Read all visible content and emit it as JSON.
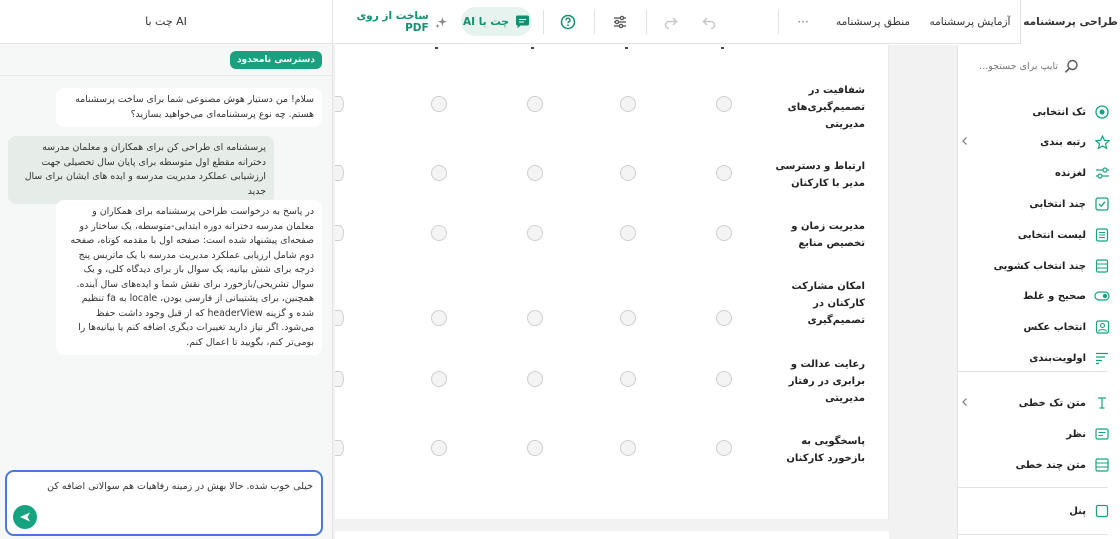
{
  "chat": {
    "title": "چت با AI",
    "badge": "دسترسی نامحدود",
    "messages": [
      {
        "role": "ai",
        "text": "سلام! من دستیار هوش مصنوعی شما برای ساخت پرسشنامه هستم. چه نوع پرسشنامه‌ای می‌خواهید بسازید؟"
      },
      {
        "role": "user",
        "text": "پرسشنامه ای طراحی کن برای همکاران و معلمان مدرسه دخترانه مقطع اول متوسطه برای پایان سال تحصیلی جهت ارزشیابی عملکرد مدیریت مدرسه و ایده های ایشان برای سال جدید"
      },
      {
        "role": "ai",
        "text": "در پاسخ به درخواست طراحی پرسشنامه برای همکاران و معلمان مدرسه دخترانه دوره ابتدایی-متوسطه، یک ساختار دو صفحه‌ای پیشنهاد شده است: صفحه اول با مقدمه کوتاه، صفحه دوم شامل ارزیابی عملکرد مدیریت مدرسه با یک ماتریس پنج درجه برای شش بیانیه، یک سوال باز برای دیدگاه کلی، و یک سوال تشریحی/بازخورد برای نقش شما و ایده‌های سال آینده. همچنین، برای پشتیبانی از فارسی بودن، locale به fa تنظیم شده و گزینه headerView که از قبل وجود داشت حفظ می‌شود. اگر نیاز دارید تغییرات دیگری اضافه کنم یا بیانیه‌ها را بومی‌تر کنم، بگویید تا اعمال کنم."
      }
    ],
    "input_value": "خیلی خوب شده. حالا بهش در زمینه رفاهیات هم سوالاتی اضافه کن"
  },
  "toolbar": {
    "tab_design": "طراحی پرسشنامه",
    "tab_test": "آزمایش پرسشنامه",
    "tab_logic": "منطق پرسشنامه",
    "more": "···",
    "ai_chat": "چت با AI",
    "pdf_build": "ساخت از روی PDF"
  },
  "matrix": {
    "rows": [
      "شفافیت در تصمیم‌گیری‌های مدیریتی",
      "ارتباط و دسترسی مدیر با کارکنان",
      "مدیریت زمان و تخصیص منابع",
      "امکان مشارکت کارکنان در تصمیم‌گیری",
      "رعایت عدالت و برابری در رفتار مدیریتی",
      "پاسخگویی به بازخورد کارکنان"
    ],
    "columns": 6
  },
  "sidebar": {
    "search_placeholder": "تایپ برای جستجو...",
    "items": [
      {
        "label": "تک انتخابی",
        "icon": "radio-icon"
      },
      {
        "label": "رتبه بندی",
        "icon": "star-icon",
        "chevron": true
      },
      {
        "label": "لغزنده",
        "icon": "slider-icon"
      },
      {
        "label": "چند انتخابی",
        "icon": "checkbox-icon"
      },
      {
        "label": "لیست انتخابی",
        "icon": "list-icon"
      },
      {
        "label": "چند انتخاب کشویی",
        "icon": "dropdown-list-icon"
      },
      {
        "label": "صحیح و غلط",
        "icon": "toggle-icon"
      },
      {
        "label": "انتخاب عکس",
        "icon": "image-icon"
      },
      {
        "label": "اولویت‌بندی",
        "icon": "ranking-icon"
      },
      {
        "label": "متن تک خطی",
        "icon": "text-line-icon",
        "chevron": true
      },
      {
        "label": "نظر",
        "icon": "comment-icon"
      },
      {
        "label": "متن چند خطی",
        "icon": "multiline-text-icon"
      },
      {
        "label": "پنل",
        "icon": "panel-icon"
      }
    ]
  },
  "colors": {
    "accent": "#16a37f",
    "input_border": "#4a79d8"
  }
}
